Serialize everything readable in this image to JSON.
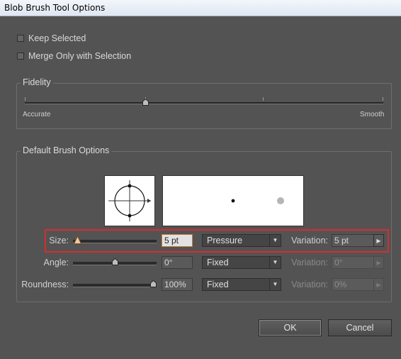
{
  "window": {
    "title": "Blob Brush Tool Options"
  },
  "checkboxes": {
    "keep_selected": {
      "label": "Keep Selected",
      "checked": false
    },
    "merge_only": {
      "label": "Merge Only with Selection",
      "checked": false
    }
  },
  "fidelity": {
    "title": "Fidelity",
    "min_label": "Accurate",
    "max_label": "Smooth",
    "value_fraction": 0.35
  },
  "brush": {
    "title": "Default Brush Options",
    "size": {
      "label": "Size:",
      "value": "5 pt",
      "mode": "Pressure",
      "variation_label": "Variation:",
      "variation_value": "5 pt"
    },
    "angle": {
      "label": "Angle:",
      "value": "0°",
      "mode": "Fixed",
      "variation_label": "Variation:",
      "variation_value": "0°"
    },
    "roundness": {
      "label": "Roundness:",
      "value": "100%",
      "mode": "Fixed",
      "variation_label": "Variation:",
      "variation_value": "0%"
    }
  },
  "buttons": {
    "ok": "OK",
    "cancel": "Cancel"
  },
  "colors": {
    "dialog_bg": "#535353",
    "highlight": "#d0302e"
  }
}
